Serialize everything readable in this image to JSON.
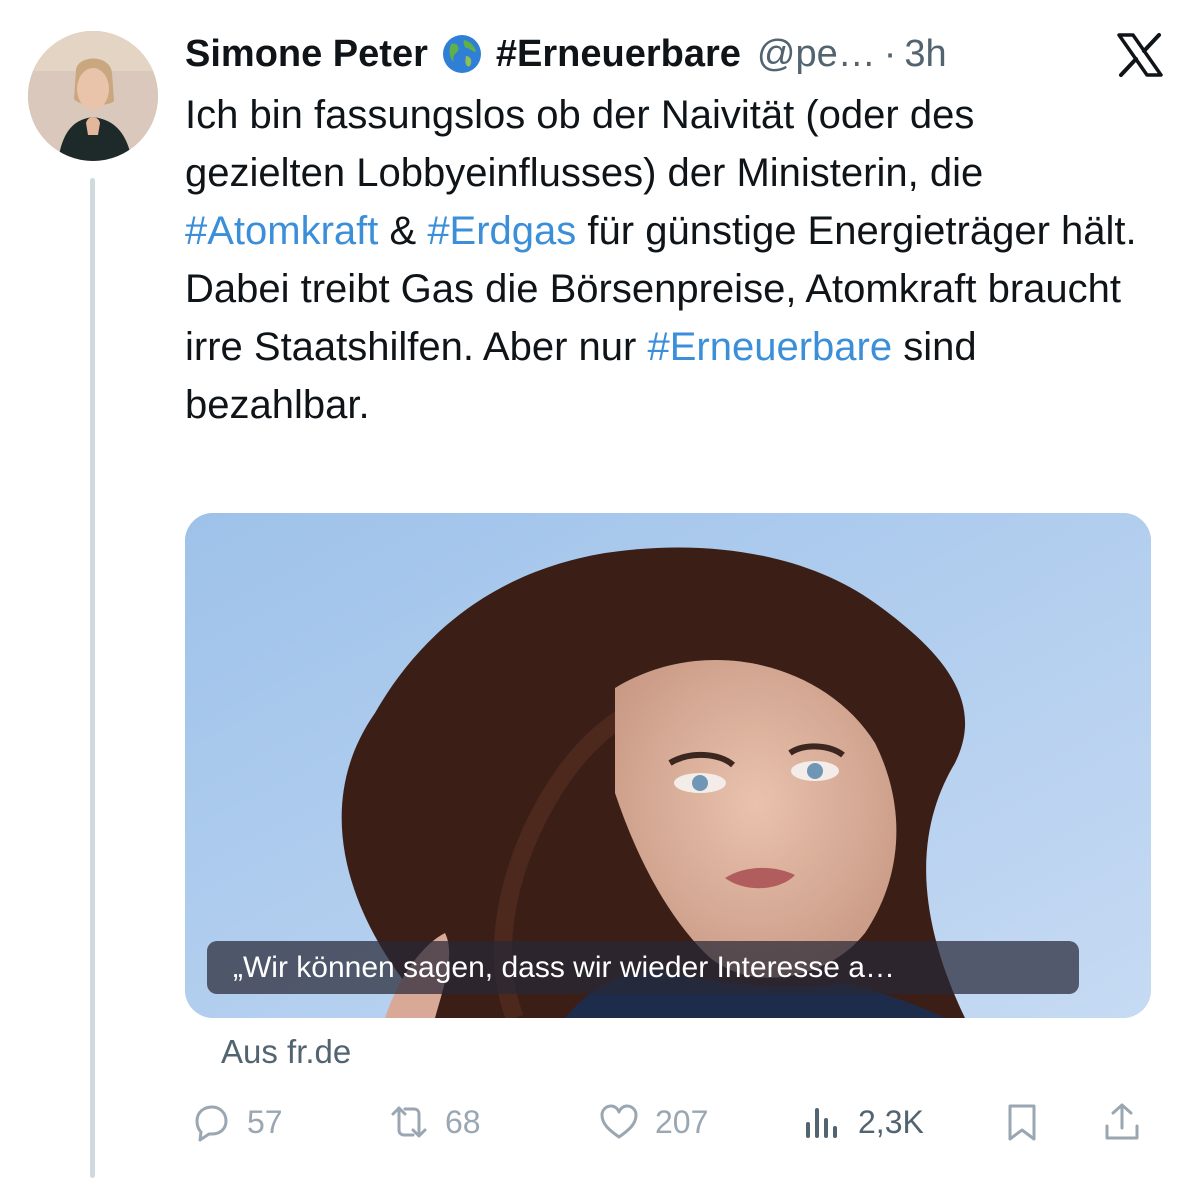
{
  "author": {
    "name": "Simone Peter",
    "emoji_icon": "globe-emoji-icon",
    "display_suffix": "#Erneuerbare",
    "handle": "@pe…",
    "separator": "·",
    "time": "3h"
  },
  "platform_icon": "x-logo-icon",
  "tweet": {
    "segments": [
      {
        "text": "Ich bin fassungslos ob der Naivität (oder des gezielten Lobbyeinflusses) der Ministerin, die ",
        "type": "text"
      },
      {
        "text": "#Atomkraft",
        "type": "hashtag"
      },
      {
        "text": " & ",
        "type": "text"
      },
      {
        "text": "#Erdgas",
        "type": "hashtag"
      },
      {
        "text": " für günstige Energieträger hält. Dabei treibt Gas die Börsenpreise, Atomkraft braucht irre Staatshilfen. Aber nur ",
        "type": "text"
      },
      {
        "text": "#Erneuerbare",
        "type": "hashtag"
      },
      {
        "text": " sind bezahlbar.",
        "type": "text"
      }
    ]
  },
  "link_card": {
    "caption": "„Wir können sagen, dass wir wieder Interesse a…",
    "source": "Aus fr.de"
  },
  "actions": {
    "replies": "57",
    "reposts": "68",
    "likes": "207",
    "views": "2,3K"
  },
  "colors": {
    "hashtag": "#3b8fd9",
    "muted": "#9aa7b2",
    "text": "#0f1419"
  }
}
